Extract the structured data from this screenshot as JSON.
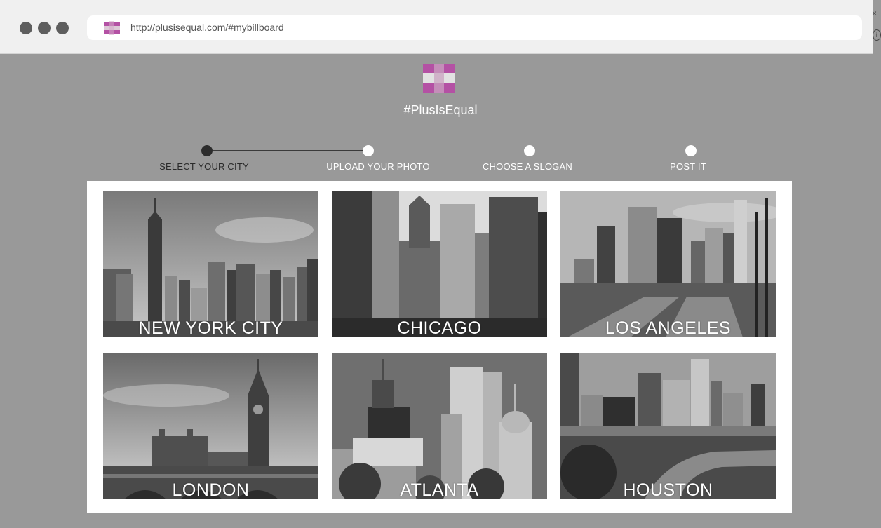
{
  "browser": {
    "url": "http://plusisequal.com/#mybillboard",
    "close_glyph": "×",
    "info_glyph": "i"
  },
  "brand": {
    "name": "#PlusIsEqual",
    "colors": {
      "magenta": "#b451a4",
      "pink": "#c7a0bd",
      "light": "#dcdcdc"
    }
  },
  "steps": [
    {
      "label": "SELECT YOUR CITY",
      "active": true
    },
    {
      "label": "UPLOAD YOUR PHOTO",
      "active": false
    },
    {
      "label": "CHOOSE A SLOGAN",
      "active": false
    },
    {
      "label": "POST IT",
      "active": false
    }
  ],
  "cities": [
    {
      "label": "NEW YORK CITY"
    },
    {
      "label": "CHICAGO"
    },
    {
      "label": "LOS ANGELES"
    },
    {
      "label": "LONDON"
    },
    {
      "label": "ATLANTA"
    },
    {
      "label": "HOUSTON"
    }
  ]
}
